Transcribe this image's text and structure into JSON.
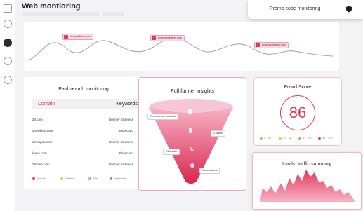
{
  "app": {
    "title": "Web montioring"
  },
  "sidebar": {
    "icons": [
      "window-icon",
      "database-icon",
      "compass-icon",
      "dollar-icon",
      "shield-icon"
    ]
  },
  "promo": {
    "label": "Promo code monitoring",
    "icon": "shield-icon"
  },
  "traffic": {
    "tags": [
      {
        "badge": "+4",
        "text": "techpublisher.com"
      },
      {
        "badge": "+4",
        "text": "couponpublisher.com"
      },
      {
        "badge": "+4",
        "text": "couponpublisher.com"
      }
    ]
  },
  "paid_search": {
    "title": "Paid search monitoring",
    "col_domain": "Domain",
    "col_keywords": "Keywords",
    "rows": [
      {
        "domain": "24.com",
        "keyword": "Bonnoy Business"
      },
      {
        "domain": "someblog.com",
        "keyword": "Blue Card"
      },
      {
        "domain": "demopub.com",
        "keyword": "Bonnoy Business"
      },
      {
        "domain": "loans.com",
        "keyword": "Blue Card"
      },
      {
        "domain": "24main.com",
        "keyword": "Bonnoy Business"
      }
    ],
    "legend": [
      "Domain",
      "Partner",
      "Ads",
      "Keywords"
    ]
  },
  "funnel": {
    "title": "Full funnel insights",
    "stages": [
      "Promotional methods",
      "Content",
      "Clicks Ad",
      "Conversions"
    ]
  },
  "fraud": {
    "title": "Fraud Score",
    "score": "86",
    "legend": [
      "0 - 30",
      "31 - 40",
      "41 - 70",
      "71 - 100"
    ]
  },
  "invalid": {
    "title": "Invalid traffic summary"
  },
  "colors": {
    "accent": "#e23757",
    "funnel_top": "#f59bb4",
    "funnel_bottom": "#dc2a52"
  }
}
